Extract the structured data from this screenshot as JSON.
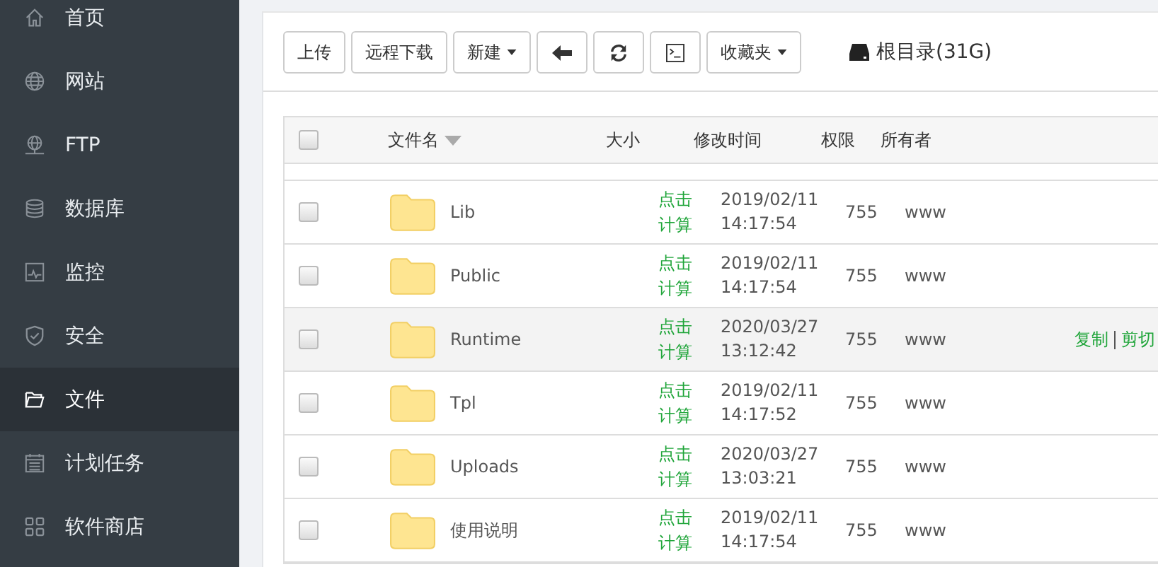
{
  "sidebar": {
    "items": [
      {
        "kind": "home",
        "label": "首页",
        "selected": false
      },
      {
        "kind": "globe",
        "label": "网站",
        "selected": false
      },
      {
        "kind": "ftp",
        "label": "FTP",
        "selected": false
      },
      {
        "kind": "database",
        "label": "数据库",
        "selected": false
      },
      {
        "kind": "monitor",
        "label": "监控",
        "selected": false
      },
      {
        "kind": "shield",
        "label": "安全",
        "selected": false
      },
      {
        "kind": "folder",
        "label": "文件",
        "selected": true
      },
      {
        "kind": "calendar",
        "label": "计划任务",
        "selected": false
      },
      {
        "kind": "grid",
        "label": "软件商店",
        "selected": false
      }
    ]
  },
  "toolbar": {
    "buttons": [
      {
        "kind": "text",
        "label": "上传"
      },
      {
        "kind": "text",
        "label": "远程下载"
      },
      {
        "kind": "dropdown",
        "label": "新建"
      },
      {
        "kind": "back"
      },
      {
        "kind": "refresh"
      },
      {
        "kind": "terminal"
      },
      {
        "kind": "dropdown",
        "label": "收藏夹"
      }
    ],
    "disk": "根目录(31G)"
  },
  "table": {
    "all_checked": false,
    "columns": [
      "文件名",
      "大小",
      "修改时间",
      "权限",
      "所有者"
    ],
    "rows": [
      {
        "name": "Lib",
        "size": "点击计算",
        "date": "2019/02/11",
        "time": "14:17:54",
        "perm": "755",
        "owner": "www",
        "highlighted": false,
        "checked": false
      },
      {
        "name": "Public",
        "size": "点击计算",
        "date": "2019/02/11",
        "time": "14:17:54",
        "perm": "755",
        "owner": "www",
        "highlighted": false,
        "checked": false
      },
      {
        "name": "Runtime",
        "size": "点击计算",
        "date": "2020/03/27",
        "time": "13:12:42",
        "perm": "755",
        "owner": "www",
        "highlighted": true,
        "checked": false,
        "actions": [
          "复制",
          "剪切"
        ]
      },
      {
        "name": "Tpl",
        "size": "点击计算",
        "date": "2019/02/11",
        "time": "14:17:52",
        "perm": "755",
        "owner": "www",
        "highlighted": false,
        "checked": false
      },
      {
        "name": "Uploads",
        "size": "点击计算",
        "date": "2020/03/27",
        "time": "13:03:21",
        "perm": "755",
        "owner": "www",
        "highlighted": false,
        "checked": false
      },
      {
        "name": "使用说明",
        "size": "点击计算",
        "date": "2019/02/11",
        "time": "14:17:54",
        "perm": "755",
        "owner": "www",
        "highlighted": false,
        "checked": false
      }
    ]
  }
}
